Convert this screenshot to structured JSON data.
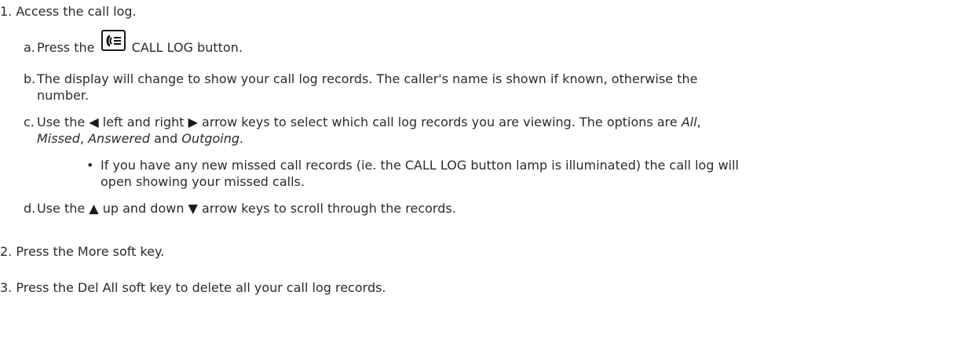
{
  "steps": [
    {
      "num": "1.",
      "text": "Access the call log."
    },
    {
      "num": "2.",
      "text": "Press the More soft key."
    },
    {
      "num": "3.",
      "text": "Press the Del All soft key to delete all your call log records."
    }
  ],
  "substeps": {
    "a": {
      "letter": "a.",
      "pre": "Press the",
      "post": "CALL LOG button.",
      "icon": "call-log-key-icon"
    },
    "b": {
      "letter": "b.",
      "line1": "The display will change to show your call log records. The caller's name is shown if known, otherwise the",
      "line2": "number."
    },
    "c": {
      "letter": "c.",
      "t1": "Use the",
      "t2": "left and right",
      "t3": "arrow keys to select which call log records you are viewing. The options are",
      "all": "All",
      "comma1": ",",
      "missed": "Missed",
      "comma2": ",",
      "answered": "Answered",
      "and": "and",
      "outgoing": "Outgoing",
      "period": "."
    },
    "bullet": {
      "line1": "If you have any new missed call records (ie. the CALL LOG button lamp is illuminated) the call log will",
      "line2": "open showing your missed calls."
    },
    "d": {
      "letter": "d.",
      "t1": "Use the",
      "t2": "up and down",
      "t3": "arrow keys to scroll through the records."
    }
  },
  "glyphs": {
    "left": "◀",
    "right": "▶",
    "up": "▲",
    "down": "▼",
    "bullet": "•"
  }
}
